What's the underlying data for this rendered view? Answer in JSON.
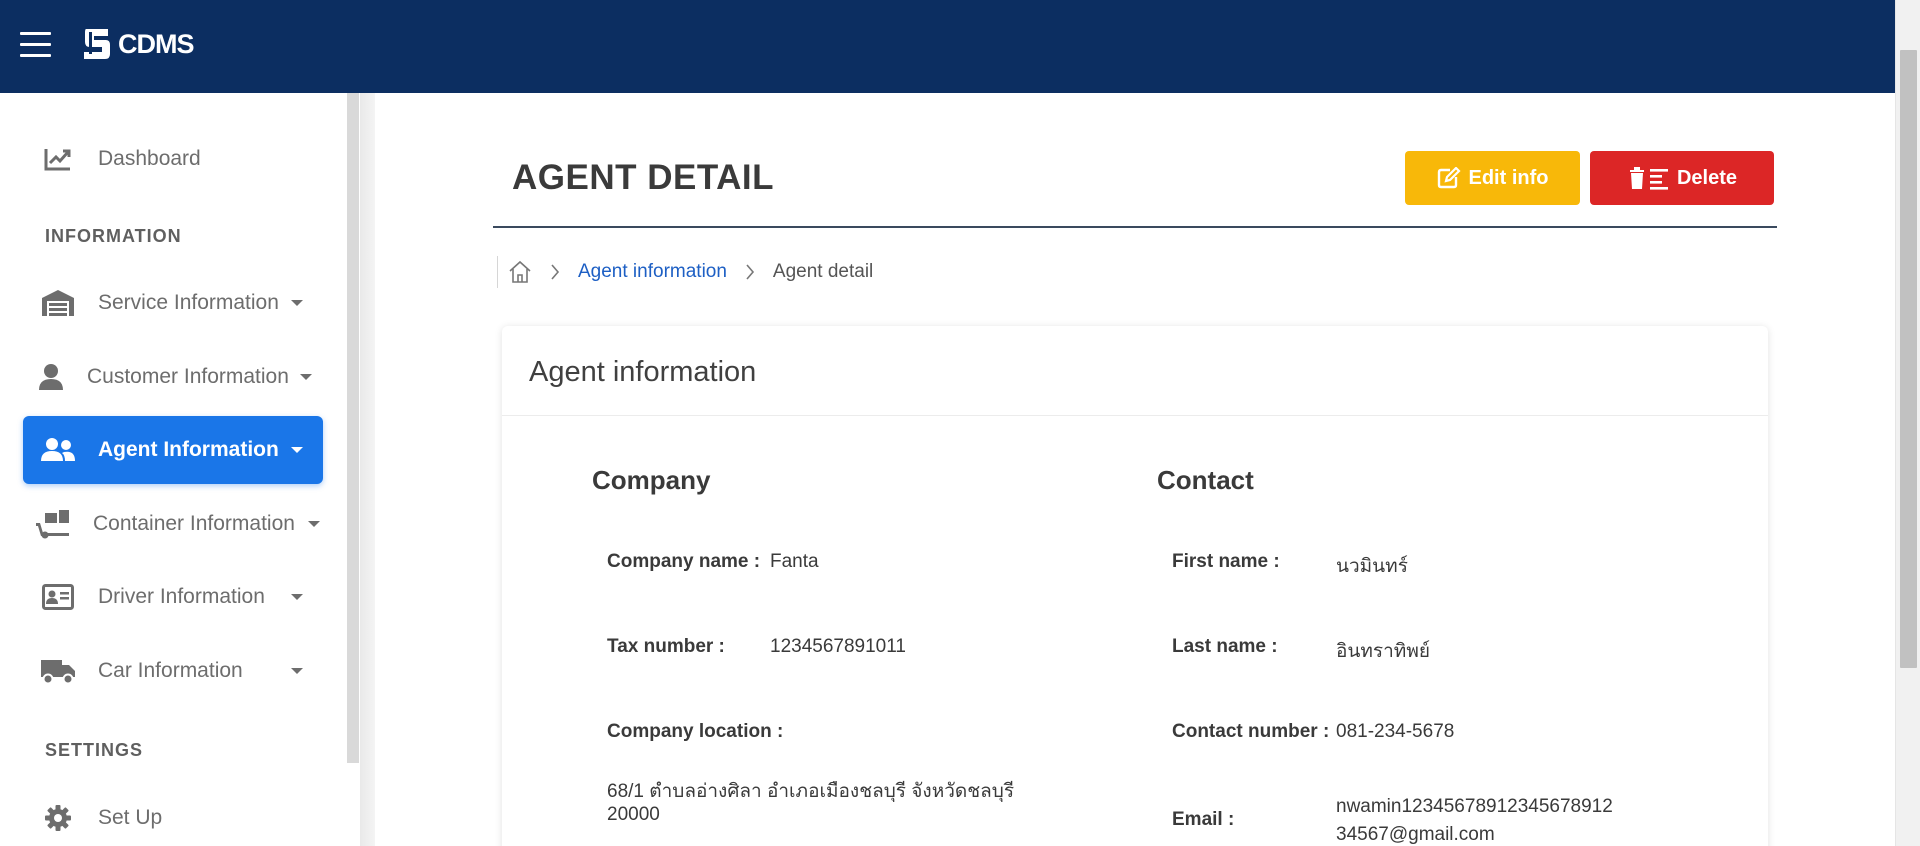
{
  "app": {
    "brand": "CDMS"
  },
  "sidebar": {
    "items": [
      {
        "label": "Dashboard",
        "icon": "chart-line-icon",
        "has_dropdown": false
      },
      {
        "label": "Service Information",
        "icon": "warehouse-icon",
        "has_dropdown": true
      },
      {
        "label": "Customer Information",
        "icon": "user-icon",
        "has_dropdown": true
      },
      {
        "label": "Agent Information",
        "icon": "users-icon",
        "has_dropdown": true,
        "active": true
      },
      {
        "label": "Container Information",
        "icon": "dolly-icon",
        "has_dropdown": true
      },
      {
        "label": "Driver Information",
        "icon": "id-card-icon",
        "has_dropdown": true
      },
      {
        "label": "Car Information",
        "icon": "truck-icon",
        "has_dropdown": true
      },
      {
        "label": "Set Up",
        "icon": "gear-icon",
        "has_dropdown": false
      }
    ],
    "sections": {
      "information": "INFORMATION",
      "settings": "SETTINGS"
    }
  },
  "header": {
    "title": "AGENT DETAIL",
    "edit_label": "Edit info",
    "delete_label": "Delete"
  },
  "breadcrumb": {
    "link": "Agent information",
    "current": "Agent detail"
  },
  "card": {
    "title": "Agent information",
    "company": {
      "heading": "Company",
      "name_label": "Company name :",
      "name_value": "Fanta",
      "tax_label": "Tax number :",
      "tax_value": "1234567891011",
      "location_label": "Company location :",
      "location_line1": "68/1 ตำบลอ่างศิลา อำเภอเมืองชลบุรี จังหวัดชลบุรี",
      "location_line2": "20000"
    },
    "contact": {
      "heading": "Contact",
      "first_label": "First name :",
      "first_value": "นวมินทร์",
      "last_label": "Last name :",
      "last_value": "อินทราทิพย์",
      "phone_label": "Contact number :",
      "phone_value": "081-234-5678",
      "email_label": "Email :",
      "email_line1": "nwamin12345678912345678912",
      "email_line2": "34567@gmail.com"
    }
  },
  "colors": {
    "topbar": "#0c2e61",
    "active_nav": "#1a76e8",
    "edit_button": "#f8b809",
    "delete_button": "#dc2626",
    "link": "#1d5fc4"
  }
}
